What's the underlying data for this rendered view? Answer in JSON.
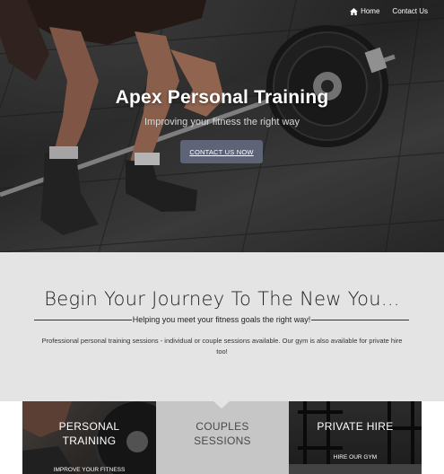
{
  "nav": {
    "home_label": "Home",
    "contact_label": "Contact Us"
  },
  "hero": {
    "title": "Apex Personal Training",
    "subtitle": "Improving your fitness the right way",
    "cta_label": "CONTACT US NOW"
  },
  "intro": {
    "heading": "Begin Your Journey To The New You...",
    "tagline": "Helping you meet your fitness goals the right way!",
    "body": "Professional personal training sessions - individual or couple sessions available. Our gym is also available for private hire too!"
  },
  "services": [
    {
      "title_line1": "PERSONAL",
      "title_line2": "TRAINING",
      "link": "IMPROVE YOUR FITNESS"
    },
    {
      "title_line1": "COUPLES",
      "title_line2": "SESSIONS",
      "link": ""
    },
    {
      "title_line1": "PRIVATE HIRE",
      "title_line2": "",
      "link": "HIRE OUR GYM"
    }
  ],
  "colors": {
    "cta_background": "#5f6378",
    "intro_background": "#e4e4e4",
    "couples_tile": "#c6c6c6"
  },
  "icons": {
    "home": "home-icon"
  }
}
